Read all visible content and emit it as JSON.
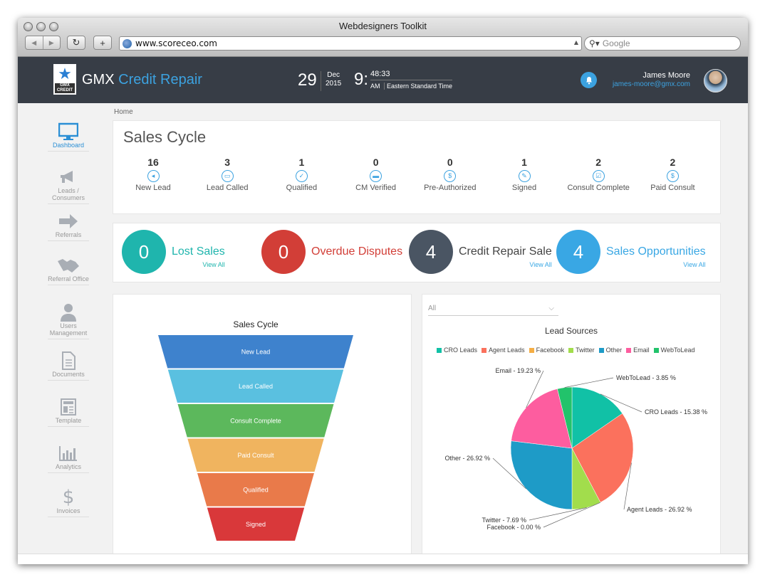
{
  "browser": {
    "window_title": "Webdesigners Toolkit",
    "url": "www.scoreceo.com",
    "search_placeholder": "Google"
  },
  "header": {
    "logo_text": "GMX CREDIT",
    "brand_gmx": "GMX",
    "brand_rest": "Credit Repair",
    "day": "29",
    "month": "Dec",
    "year": "2015",
    "hour": "9:",
    "minutes": "48:33",
    "ampm": "AM",
    "timezone": "Eastern Standard Time",
    "user_name": "James Moore",
    "user_email": "james-moore@gmx.com"
  },
  "sidebar": {
    "items": [
      {
        "label": "Dashboard",
        "icon": "monitor-icon"
      },
      {
        "label": "Leads / Consumers",
        "icon": "megaphone-icon"
      },
      {
        "label": "Referrals",
        "icon": "arrow-right-icon"
      },
      {
        "label": "Referral Office",
        "icon": "handshake-icon"
      },
      {
        "label": "Users Management",
        "icon": "user-icon"
      },
      {
        "label": "Documents",
        "icon": "document-icon"
      },
      {
        "label": "Template",
        "icon": "template-icon"
      },
      {
        "label": "Analytics",
        "icon": "bar-chart-icon"
      },
      {
        "label": "Invoices",
        "icon": "dollar-icon"
      }
    ]
  },
  "breadcrumb": "Home",
  "sales_cycle": {
    "title": "Sales Cycle",
    "stages": [
      {
        "count": "16",
        "label": "New Lead",
        "icon": "megaphone-icon",
        "glyph": "◂"
      },
      {
        "count": "3",
        "label": "Lead Called",
        "icon": "chat-icon",
        "glyph": "▭"
      },
      {
        "count": "1",
        "label": "Qualified",
        "icon": "check-icon",
        "glyph": "✓"
      },
      {
        "count": "0",
        "label": "CM Verified",
        "icon": "card-icon",
        "glyph": "▬"
      },
      {
        "count": "0",
        "label": "Pre-Authorized",
        "icon": "dollar-icon",
        "glyph": "$"
      },
      {
        "count": "1",
        "label": "Signed",
        "icon": "pen-icon",
        "glyph": "✎"
      },
      {
        "count": "2",
        "label": "Consult Complete",
        "icon": "checkbox-icon",
        "glyph": "☑"
      },
      {
        "count": "2",
        "label": "Paid Consult",
        "icon": "dollar-icon",
        "glyph": "$"
      }
    ]
  },
  "kpis": [
    {
      "value": "0",
      "title": "Lost Sales",
      "link": "View All",
      "color": "#1fb5ad",
      "text_color": "#1fb5ad"
    },
    {
      "value": "0",
      "title": "Overdue Disputes",
      "link": "",
      "color": "#d23e37",
      "text_color": "#d23e37"
    },
    {
      "value": "4",
      "title": "Credit Repair Sale",
      "link": "View All",
      "color": "#4a5563",
      "text_color": "#444444"
    },
    {
      "value": "4",
      "title": "Sales Opportunities",
      "link": "View All",
      "color": "#39a7e4",
      "text_color": "#39a7e4"
    }
  ],
  "funnel": {
    "title": "Sales Cycle",
    "stages": [
      {
        "label": "New Lead",
        "color": "#3e82cd"
      },
      {
        "label": "Lead Called",
        "color": "#5ac0e0"
      },
      {
        "label": "Consult Complete",
        "color": "#5cb85c"
      },
      {
        "label": "Paid Consult",
        "color": "#f0b45f"
      },
      {
        "label": "Qualified",
        "color": "#e97a4a"
      },
      {
        "label": "Signed",
        "color": "#d9383a"
      }
    ]
  },
  "lead_filter": {
    "selected": "All"
  },
  "chart_data": {
    "type": "pie",
    "title": "Lead Sources",
    "legend_position": "top",
    "series": [
      {
        "name": "CRO Leads",
        "value": 15.38,
        "label": "CRO Leads - 15.38 %",
        "color": "#11c1a6"
      },
      {
        "name": "Agent Leads",
        "value": 26.92,
        "label": "Agent Leads - 26.92 %",
        "color": "#fb715d"
      },
      {
        "name": "Facebook",
        "value": 0.0,
        "label": "Facebook - 0.00 %",
        "color": "#f5ae45"
      },
      {
        "name": "Twitter",
        "value": 7.69,
        "label": "Twitter - 7.69 %",
        "color": "#a2dd4c"
      },
      {
        "name": "Other",
        "value": 26.92,
        "label": "Other - 26.92 %",
        "color": "#1e9bc7"
      },
      {
        "name": "Email",
        "value": 19.23,
        "label": "Email - 19.23 %",
        "color": "#fd5d9f"
      },
      {
        "name": "WebToLead",
        "value": 3.85,
        "label": "WebToLead - 3.85 %",
        "color": "#22c36b"
      }
    ]
  }
}
